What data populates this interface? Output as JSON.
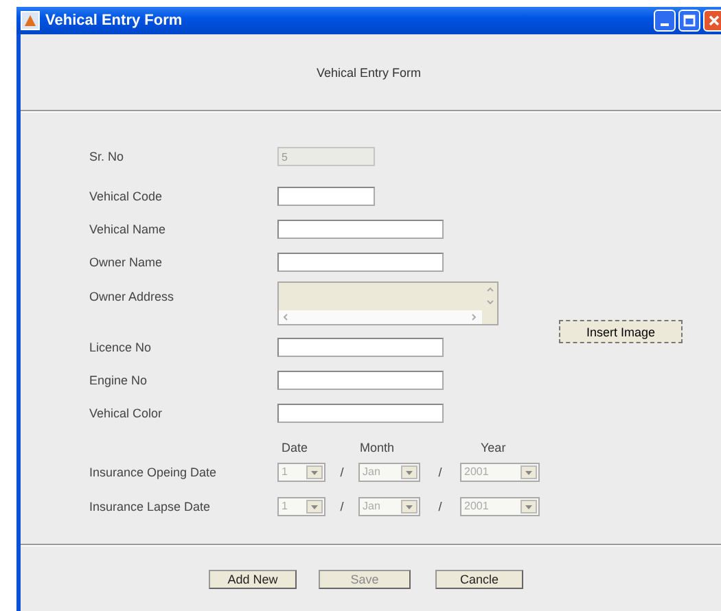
{
  "window": {
    "title": "Vehical Entry Form"
  },
  "header": "Vehical Entry Form",
  "fields": [
    {
      "label": "Sr. No",
      "kind": "short",
      "value": "5",
      "disabled": true
    },
    {
      "label": "Vehical Code",
      "kind": "short",
      "disabled": false
    },
    {
      "label": "Vehical Name",
      "kind": "long",
      "disabled": false
    },
    {
      "label": "Owner Name",
      "kind": "long",
      "disabled": false
    },
    {
      "label": "Owner Address",
      "kind": "area",
      "disabled": true,
      "button": "Insert Image"
    },
    {
      "label": "Licence No",
      "kind": "long",
      "disabled": false
    },
    {
      "label": "Engine No",
      "kind": "long",
      "disabled": false
    },
    {
      "label": "Vehical Color",
      "kind": "long",
      "disabled": false
    }
  ],
  "date_headers": [
    "Date",
    "Month",
    "Year"
  ],
  "date_rows": [
    {
      "label": "Insurance Opeing Date",
      "separators": [
        "/",
        "/"
      ],
      "combos": [
        {
          "value": "1",
          "disabled": true
        },
        {
          "value": "Jan",
          "disabled": true
        },
        {
          "value": "2001",
          "disabled": true
        }
      ]
    },
    {
      "label": "Insurance Lapse Date",
      "separators": [
        "/",
        "/"
      ],
      "combos": [
        {
          "value": "1",
          "disabled": true
        },
        {
          "value": "Jan",
          "disabled": true
        },
        {
          "value": "2001",
          "disabled": true
        }
      ]
    }
  ],
  "buttons": [
    {
      "label": "Add New",
      "disabled": false
    },
    {
      "label": "Save",
      "disabled": true
    },
    {
      "label": "Cancle",
      "disabled": false
    }
  ]
}
